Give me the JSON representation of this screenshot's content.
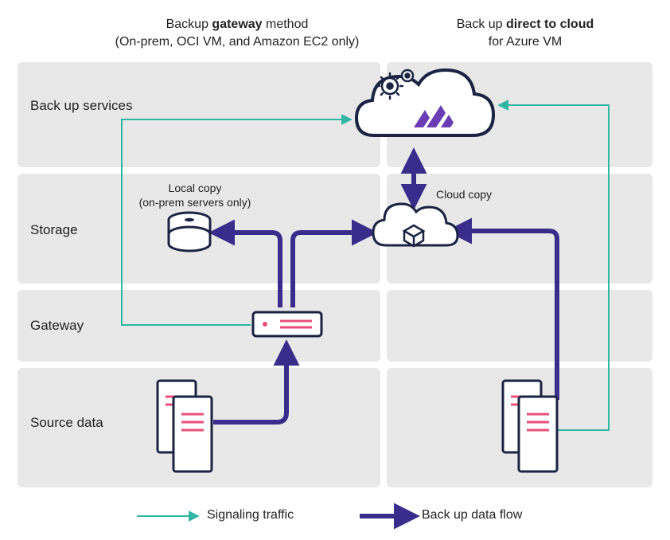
{
  "columns": {
    "left": {
      "line1_pre": "Backup ",
      "line1_em": "gateway",
      "line1_post": " method",
      "line2": "(On-prem, OCI VM, and Amazon EC2 only)"
    },
    "right": {
      "line1_pre": "Back up ",
      "line1_em": "direct to cloud",
      "line1_post": "",
      "line2": "for Azure VM"
    }
  },
  "rows": {
    "r1": "Back up services",
    "r1b": "",
    "r2": "Storage",
    "r3": "Gateway",
    "r4": "Source data",
    "r4b": ""
  },
  "icons": {
    "local_copy_l1": "Local copy",
    "local_copy_l2": "(on-prem servers only)",
    "cloud_copy": "Cloud copy"
  },
  "legend": {
    "signal": "Signaling traffic",
    "data": "Back up data flow"
  },
  "colors": {
    "teal": "#2fb6a3",
    "purple": "#3a2c8a",
    "pink": "#e94f7a",
    "navy": "#1a2342",
    "magenta": "#6a3db5"
  }
}
